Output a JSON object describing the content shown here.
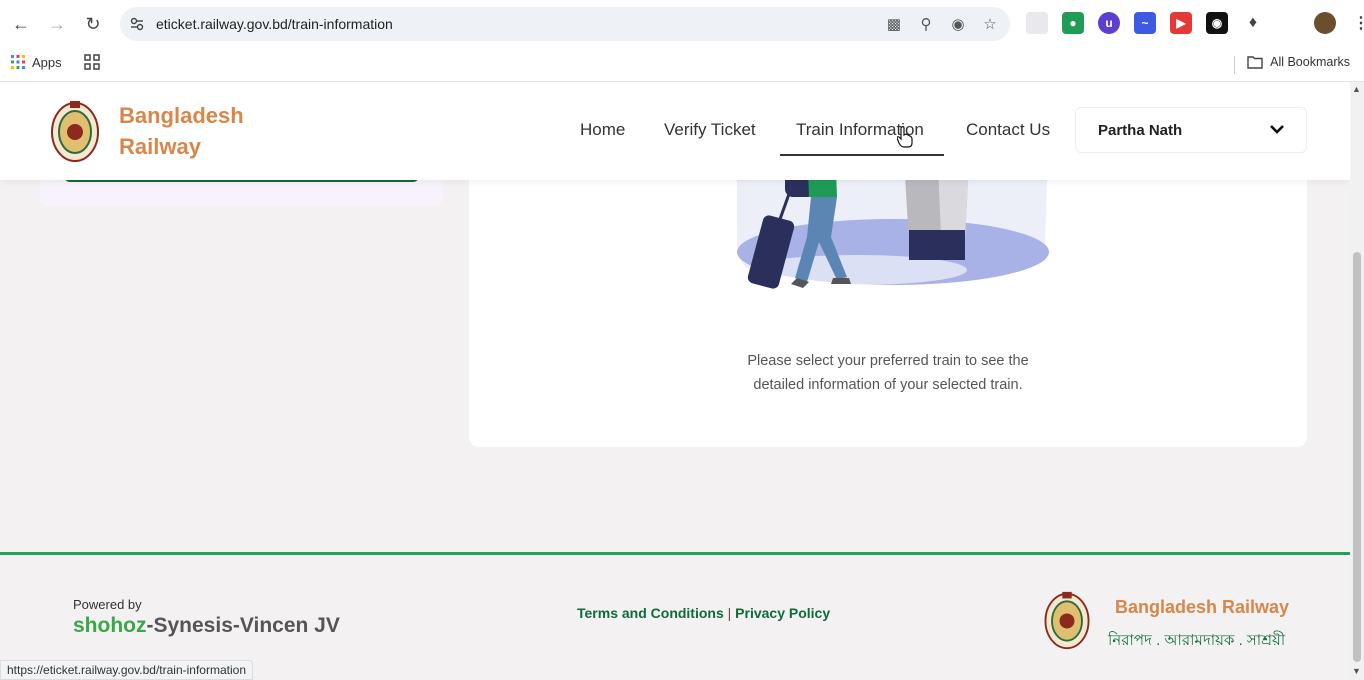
{
  "browser": {
    "url": "eticket.railway.gov.bd/train-information",
    "bookmarks": {
      "apps_label": "Apps",
      "all_bookmarks_label": "All Bookmarks"
    }
  },
  "site": {
    "brand_line1": "Bangladesh",
    "brand_line2": "Railway",
    "nav": [
      "Home",
      "Verify Ticket",
      "Train Information",
      "Contact Us"
    ],
    "active_nav": "Train Information",
    "user_name": "Partha Nath"
  },
  "main": {
    "message_line1": "Please select your preferred train to see the",
    "message_line2": "detailed information of your selected train."
  },
  "footer": {
    "powered_by": "Powered by",
    "shohoz_green": "shohoz",
    "shohoz_rest": "-Synesis-Vincen JV",
    "terms": "Terms and Conditions",
    "separator": "|",
    "privacy": "Privacy Policy",
    "brand": "Bangladesh Railway",
    "tagline": "নিরাপদ . আরামদায়ক . সাশ্রয়ী"
  },
  "status_tooltip": "https://eticket.railway.gov.bd/train-information",
  "colors": {
    "brand_orange": "#d8874a",
    "brand_green": "#0e6c39",
    "footer_line": "#23a35a"
  }
}
